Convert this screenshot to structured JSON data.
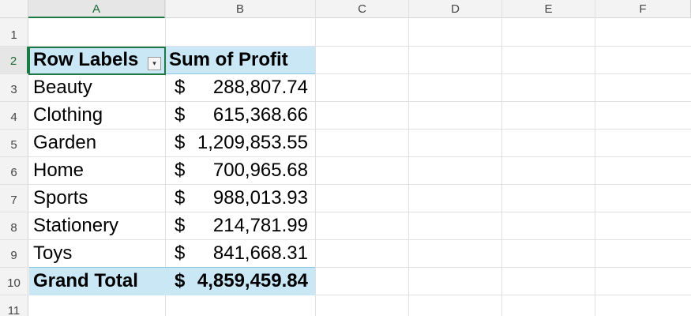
{
  "columns": [
    "A",
    "B",
    "C",
    "D",
    "E",
    "F"
  ],
  "rows": [
    "1",
    "2",
    "3",
    "4",
    "5",
    "6",
    "7",
    "8",
    "9",
    "10",
    "11"
  ],
  "pivot": {
    "header_label": "Row Labels",
    "header_value": "Sum of Profit",
    "items": [
      {
        "label": "Beauty",
        "currency": "$",
        "amount": "288,807.74"
      },
      {
        "label": "Clothing",
        "currency": "$",
        "amount": "615,368.66"
      },
      {
        "label": "Garden",
        "currency": "$",
        "amount": "1,209,853.55"
      },
      {
        "label": "Home",
        "currency": "$",
        "amount": "700,965.68"
      },
      {
        "label": "Sports",
        "currency": "$",
        "amount": "988,013.93"
      },
      {
        "label": "Stationery",
        "currency": "$",
        "amount": "214,781.99"
      },
      {
        "label": "Toys",
        "currency": "$",
        "amount": "841,668.31"
      }
    ],
    "total": {
      "label": "Grand Total",
      "currency": "$",
      "amount": "4,859,459.84"
    }
  },
  "colors": {
    "accent": "#1d7a44",
    "band": "#c9e7f5"
  },
  "icons": {
    "filter_dropdown": "chevron-down-icon"
  }
}
